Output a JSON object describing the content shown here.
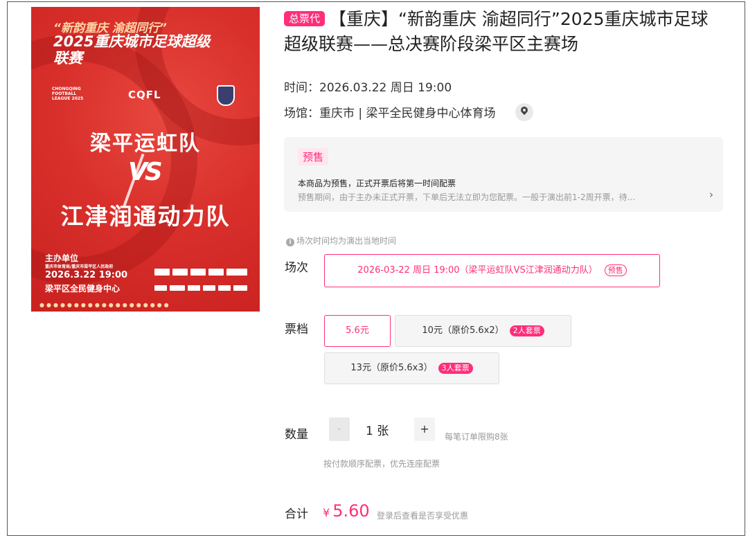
{
  "poster": {
    "slogan": "“新韵重庆 渝超同行”",
    "league_title": "2025重庆城市足球超级联赛",
    "cqfl_small": "CHONGQING FOOTBALL LEAGUE 2025",
    "cqfl": "CQFL",
    "team_a": "梁平运虹队",
    "vs": "VS",
    "team_b": "江津润通动力队",
    "organizer_title": "主办单位",
    "organizer_line": "重庆市体育局/重庆市梁平区人民政府",
    "date": "2026.3.22  19:00",
    "venue": "梁平区全民健身中心"
  },
  "product": {
    "type_tag": "总票代",
    "title": "【重庆】“新韵重庆 渝超同行”2025重庆城市足球超级联赛——总决赛阶段梁平区主赛场",
    "time": "时间：2026.03.22 周日 19:00",
    "venue": "场馆：重庆市 | 梁平全民健身中心体育场"
  },
  "presale": {
    "tag": "预售",
    "main": "本商品为预售，正式开票后将第一时间配票",
    "sub": "预售期间，由于主办未正式开票，下单后无法立即为您配票。一般于演出前1-2周开票，待..."
  },
  "timezone_note": "场次时间均为演出当地时间",
  "session": {
    "label": "场次",
    "option": "2026-03-22 周日 19:00（梁平运虹队VS江津润通动力队）",
    "option_tag": "预售"
  },
  "tickets": {
    "label": "票档",
    "options": [
      {
        "price": "5.6元",
        "tag": ""
      },
      {
        "price": "10元（原价5.6x2）",
        "tag": "2人套票"
      },
      {
        "price": "13元（原价5.6x3）",
        "tag": "3人套票"
      }
    ]
  },
  "quantity": {
    "label": "数量",
    "minus": "-",
    "value": "1 张",
    "plus": "+",
    "limit": "每笔订单限购8张",
    "note": "按付款顺序配票，优先连座配票"
  },
  "total": {
    "label": "合计",
    "currency": "¥",
    "amount": "5.60",
    "hint": "登录后查看是否享受优惠"
  },
  "colors": {
    "accent": "#ff2e7a",
    "poster_red": "#d9302c"
  }
}
